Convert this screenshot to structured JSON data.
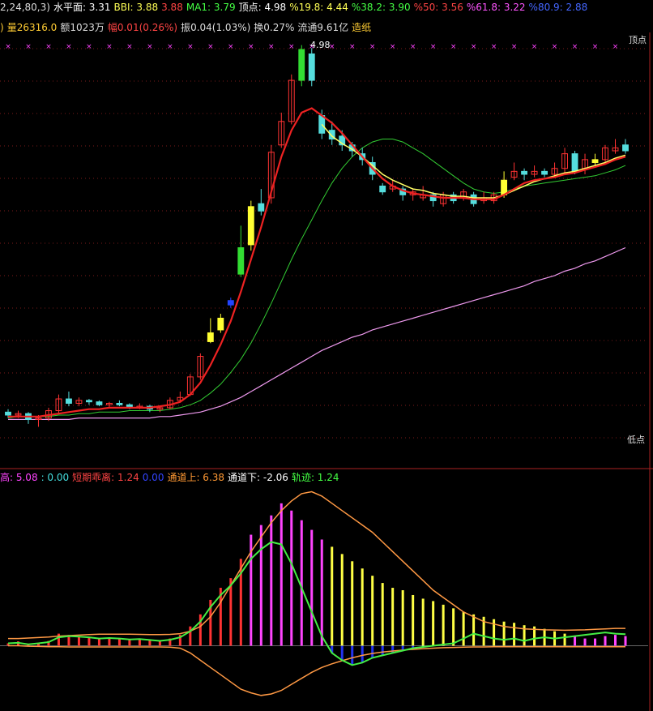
{
  "header1": [
    {
      "text": "2,24,80,3)",
      "color": "#dddddd"
    },
    {
      "text": "水平面: 3.31",
      "color": "#ffffff"
    },
    {
      "text": "BBI: 3.88",
      "color": "#ffff55"
    },
    {
      "text": "3.88",
      "color": "#ff4444"
    },
    {
      "text": "MA1: 3.79",
      "color": "#44ff44"
    },
    {
      "text": "顶点: 4.98",
      "color": "#ffffff"
    },
    {
      "text": "%19.8: 4.44",
      "color": "#ffff55"
    },
    {
      "text": "%38.2: 3.90",
      "color": "#44ff44"
    },
    {
      "text": "%50: 3.56",
      "color": "#ff4444"
    },
    {
      "text": "%61.8: 3.22",
      "color": "#ff55ff"
    },
    {
      "text": "%80.9: 2.88",
      "color": "#4466ff"
    }
  ],
  "header2": [
    {
      "text": ")",
      "color": "#ffcc33"
    },
    {
      "text": "量26316.0",
      "color": "#ffcc33"
    },
    {
      "text": "额1023万",
      "color": "#dddddd"
    },
    {
      "text": "幅0.01(0.26%)",
      "color": "#ff4444"
    },
    {
      "text": "振0.04(1.03%)",
      "color": "#dddddd"
    },
    {
      "text": "换0.27%",
      "color": "#dddddd"
    },
    {
      "text": "流通9.61亿",
      "color": "#dddddd"
    },
    {
      "text": "造纸",
      "color": "#ffcc33"
    }
  ],
  "header3": [
    {
      "text": "高: 5.08",
      "color": "#ff44ff"
    },
    {
      "text": ": 0.00",
      "color": "#44dddd"
    },
    {
      "text": "短期乖离: 1.24",
      "color": "#ff4444"
    },
    {
      "text": "0.00",
      "color": "#3344ff"
    },
    {
      "text": "通道上: 6.38",
      "color": "#ff9933"
    },
    {
      "text": "通道下: -2.06",
      "color": "#ffffff"
    },
    {
      "text": "轨迹: 1.24",
      "color": "#44ff44"
    }
  ],
  "labels": {
    "peak_value": "4.98",
    "top_point": "顶点",
    "low_point": "低点"
  },
  "chart_data": [
    {
      "type": "candlestick",
      "title": "",
      "ylim": [
        2.25,
        5.0
      ],
      "candles": [
        [
          2.48,
          2.46,
          2.5,
          2.44
        ],
        [
          2.46,
          2.47,
          2.49,
          2.44
        ],
        [
          2.47,
          2.43,
          2.48,
          2.4
        ],
        [
          2.43,
          2.44,
          2.46,
          2.38
        ],
        [
          2.44,
          2.49,
          2.51,
          2.42
        ],
        [
          2.49,
          2.57,
          2.6,
          2.47
        ],
        [
          2.57,
          2.54,
          2.62,
          2.52
        ],
        [
          2.54,
          2.56,
          2.58,
          2.52
        ],
        [
          2.56,
          2.55,
          2.57,
          2.53
        ],
        [
          2.55,
          2.53,
          2.56,
          2.52
        ],
        [
          2.53,
          2.54,
          2.55,
          2.51
        ],
        [
          2.54,
          2.53,
          2.56,
          2.52
        ],
        [
          2.53,
          2.51,
          2.54,
          2.5
        ],
        [
          2.51,
          2.52,
          2.54,
          2.5
        ],
        [
          2.52,
          2.5,
          2.53,
          2.48
        ],
        [
          2.5,
          2.51,
          2.52,
          2.48
        ],
        [
          2.51,
          2.56,
          2.58,
          2.5
        ],
        [
          2.56,
          2.58,
          2.62,
          2.55
        ],
        [
          2.6,
          2.72,
          2.74,
          2.59
        ],
        [
          2.72,
          2.86,
          2.88,
          2.7
        ],
        [
          2.96,
          3.02,
          3.12,
          2.95
        ],
        [
          3.04,
          3.12,
          3.15,
          3.02
        ],
        [
          3.24,
          3.21,
          3.26,
          3.19
        ],
        [
          3.42,
          3.6,
          3.75,
          3.4
        ],
        [
          3.62,
          3.88,
          3.92,
          3.58
        ],
        [
          3.9,
          3.85,
          4.0,
          3.82
        ],
        [
          3.94,
          4.25,
          4.3,
          3.9
        ],
        [
          4.3,
          4.46,
          4.52,
          4.28
        ],
        [
          4.46,
          4.74,
          4.78,
          4.44
        ],
        [
          4.74,
          4.95,
          4.98,
          4.7
        ],
        [
          4.92,
          4.74,
          4.96,
          4.7
        ],
        [
          4.5,
          4.38,
          4.54,
          4.34
        ],
        [
          4.4,
          4.34,
          4.46,
          4.3
        ],
        [
          4.36,
          4.3,
          4.4,
          4.26
        ],
        [
          4.3,
          4.26,
          4.32,
          4.22
        ],
        [
          4.24,
          4.2,
          4.28,
          4.16
        ],
        [
          4.18,
          4.1,
          4.22,
          4.06
        ],
        [
          4.02,
          3.98,
          4.04,
          3.96
        ],
        [
          4.0,
          4.02,
          4.06,
          3.98
        ],
        [
          4.0,
          3.96,
          4.02,
          3.92
        ],
        [
          3.96,
          3.98,
          4.0,
          3.92
        ],
        [
          3.94,
          3.96,
          4.02,
          3.92
        ],
        [
          3.96,
          3.92,
          3.98,
          3.88
        ],
        [
          3.9,
          3.96,
          3.98,
          3.88
        ],
        [
          3.96,
          3.92,
          3.98,
          3.9
        ],
        [
          3.94,
          3.98,
          4.0,
          3.92
        ],
        [
          3.96,
          3.9,
          3.98,
          3.88
        ],
        [
          3.92,
          3.94,
          3.98,
          3.9
        ],
        [
          3.92,
          3.96,
          3.98,
          3.9
        ],
        [
          3.96,
          4.06,
          4.12,
          3.94
        ],
        [
          4.08,
          4.12,
          4.18,
          4.06
        ],
        [
          4.12,
          4.1,
          4.14,
          4.06
        ],
        [
          4.1,
          4.12,
          4.16,
          4.08
        ],
        [
          4.12,
          4.1,
          4.14,
          4.08
        ],
        [
          4.1,
          4.14,
          4.18,
          4.08
        ],
        [
          4.14,
          4.24,
          4.28,
          4.1
        ],
        [
          4.24,
          4.12,
          4.26,
          4.1
        ],
        [
          4.14,
          4.2,
          4.24,
          4.1
        ],
        [
          4.18,
          4.2,
          4.24,
          4.16
        ],
        [
          4.2,
          4.28,
          4.3,
          4.18
        ],
        [
          4.26,
          4.28,
          4.34,
          4.24
        ],
        [
          4.3,
          4.26,
          4.34,
          4.24
        ]
      ],
      "ma_red": [
        2.45,
        2.45,
        2.45,
        2.45,
        2.46,
        2.47,
        2.48,
        2.49,
        2.5,
        2.5,
        2.51,
        2.51,
        2.51,
        2.51,
        2.51,
        2.52,
        2.53,
        2.55,
        2.6,
        2.68,
        2.8,
        2.94,
        3.1,
        3.3,
        3.52,
        3.74,
        3.98,
        4.22,
        4.4,
        4.52,
        4.55,
        4.5,
        4.45,
        4.38,
        4.3,
        4.22,
        4.14,
        4.07,
        4.02,
        3.99,
        3.97,
        3.96,
        3.95,
        3.94,
        3.94,
        3.94,
        3.93,
        3.93,
        3.93,
        3.96,
        4.0,
        4.04,
        4.06,
        4.07,
        4.08,
        4.1,
        4.11,
        4.13,
        4.15,
        4.17,
        4.2,
        4.22
      ],
      "ma_yellow": [
        null,
        null,
        null,
        null,
        null,
        null,
        null,
        null,
        null,
        null,
        null,
        null,
        null,
        null,
        null,
        null,
        null,
        null,
        null,
        null,
        null,
        null,
        null,
        null,
        null,
        null,
        null,
        null,
        null,
        null,
        null,
        4.44,
        4.36,
        4.31,
        4.27,
        4.22,
        4.16,
        4.1,
        4.06,
        4.03,
        4.0,
        3.99,
        3.97,
        3.96,
        3.95,
        3.95,
        3.94,
        3.94,
        3.94,
        3.96,
        3.99,
        4.02,
        4.05,
        4.07,
        4.09,
        4.11,
        4.12,
        4.14,
        4.16,
        4.18,
        4.21,
        4.23
      ],
      "ma_green": [
        2.44,
        2.45,
        2.45,
        2.45,
        2.45,
        2.46,
        2.46,
        2.47,
        2.47,
        2.48,
        2.48,
        2.48,
        2.49,
        2.49,
        2.49,
        2.49,
        2.5,
        2.51,
        2.53,
        2.56,
        2.61,
        2.67,
        2.75,
        2.84,
        2.95,
        3.08,
        3.22,
        3.37,
        3.52,
        3.66,
        3.79,
        3.92,
        4.04,
        4.14,
        4.22,
        4.28,
        4.32,
        4.34,
        4.34,
        4.32,
        4.28,
        4.24,
        4.19,
        4.14,
        4.09,
        4.04,
        4.0,
        3.98,
        3.97,
        3.98,
        4.0,
        4.02,
        4.03,
        4.04,
        4.05,
        4.06,
        4.07,
        4.08,
        4.09,
        4.11,
        4.13,
        4.16
      ],
      "ma_pink": [
        2.43,
        2.43,
        2.43,
        2.43,
        2.43,
        2.43,
        2.43,
        2.44,
        2.44,
        2.44,
        2.44,
        2.44,
        2.44,
        2.44,
        2.44,
        2.45,
        2.45,
        2.46,
        2.47,
        2.48,
        2.5,
        2.52,
        2.55,
        2.58,
        2.62,
        2.66,
        2.7,
        2.74,
        2.78,
        2.82,
        2.86,
        2.9,
        2.93,
        2.96,
        2.99,
        3.01,
        3.04,
        3.06,
        3.08,
        3.1,
        3.12,
        3.14,
        3.16,
        3.18,
        3.2,
        3.22,
        3.24,
        3.26,
        3.28,
        3.3,
        3.32,
        3.34,
        3.37,
        3.39,
        3.41,
        3.44,
        3.46,
        3.49,
        3.51,
        3.54,
        3.57,
        3.6
      ]
    },
    {
      "type": "bar",
      "title": "",
      "ylim": [
        -2.2,
        6.6
      ],
      "bars": [
        0.1,
        0.18,
        0.05,
        0.12,
        0.2,
        0.5,
        0.45,
        0.4,
        0.36,
        0.3,
        0.34,
        0.3,
        0.25,
        0.28,
        0.22,
        0.2,
        0.3,
        0.45,
        0.8,
        1.3,
        1.9,
        2.4,
        2.8,
        3.6,
        4.6,
        5.0,
        5.4,
        5.9,
        5.6,
        5.2,
        4.8,
        4.4,
        4.1,
        3.8,
        3.5,
        3.2,
        2.9,
        2.6,
        2.4,
        2.3,
        2.1,
        1.95,
        1.85,
        1.7,
        1.55,
        1.4,
        1.3,
        1.2,
        1.1,
        1.0,
        0.95,
        0.85,
        0.8,
        0.7,
        0.6,
        0.5,
        0.4,
        0.3,
        0.3,
        0.4,
        0.45,
        0.4
      ],
      "fast": [
        0.1,
        0.12,
        0.06,
        0.1,
        0.15,
        0.35,
        0.4,
        0.38,
        0.35,
        0.3,
        0.32,
        0.3,
        0.26,
        0.28,
        0.24,
        0.2,
        0.25,
        0.35,
        0.6,
        1.0,
        1.6,
        2.1,
        2.5,
        3.0,
        3.6,
        4.0,
        4.3,
        4.2,
        3.4,
        2.4,
        1.4,
        0.4,
        -0.3,
        -0.6,
        -0.8,
        -0.7,
        -0.5,
        -0.4,
        -0.3,
        -0.2,
        -0.1,
        -0.05,
        0.0,
        0.05,
        0.1,
        0.3,
        0.5,
        0.4,
        0.3,
        0.25,
        0.3,
        0.2,
        0.3,
        0.35,
        0.3,
        0.35,
        0.4,
        0.45,
        0.5,
        0.55,
        0.5,
        0.48
      ],
      "upper": [
        0.3,
        0.3,
        0.32,
        0.34,
        0.36,
        0.4,
        0.42,
        0.44,
        0.46,
        0.48,
        0.48,
        0.48,
        0.48,
        0.47,
        0.46,
        0.46,
        0.47,
        0.5,
        0.6,
        0.8,
        1.2,
        1.8,
        2.5,
        3.2,
        3.9,
        4.5,
        5.1,
        5.6,
        6.0,
        6.3,
        6.38,
        6.2,
        5.9,
        5.6,
        5.3,
        5.0,
        4.7,
        4.3,
        3.9,
        3.5,
        3.1,
        2.7,
        2.3,
        2.0,
        1.7,
        1.4,
        1.2,
        1.0,
        0.9,
        0.8,
        0.75,
        0.7,
        0.68,
        0.66,
        0.65,
        0.64,
        0.65,
        0.66,
        0.68,
        0.7,
        0.72,
        0.72
      ],
      "lower": [
        0.0,
        0.0,
        -0.02,
        -0.03,
        -0.04,
        -0.04,
        -0.05,
        -0.05,
        -0.05,
        -0.05,
        -0.05,
        -0.05,
        -0.05,
        -0.05,
        -0.05,
        -0.05,
        -0.06,
        -0.1,
        -0.3,
        -0.6,
        -0.9,
        -1.2,
        -1.5,
        -1.8,
        -1.95,
        -2.06,
        -2.0,
        -1.85,
        -1.6,
        -1.35,
        -1.1,
        -0.9,
        -0.75,
        -0.62,
        -0.5,
        -0.4,
        -0.32,
        -0.26,
        -0.22,
        -0.18,
        -0.15,
        -0.12,
        -0.1,
        -0.08,
        -0.07,
        -0.06,
        -0.05,
        -0.05,
        -0.04,
        -0.04,
        -0.04,
        -0.04,
        -0.04,
        -0.04,
        -0.04,
        -0.04,
        -0.04,
        -0.04,
        -0.04,
        -0.04,
        -0.04,
        -0.04
      ]
    }
  ]
}
